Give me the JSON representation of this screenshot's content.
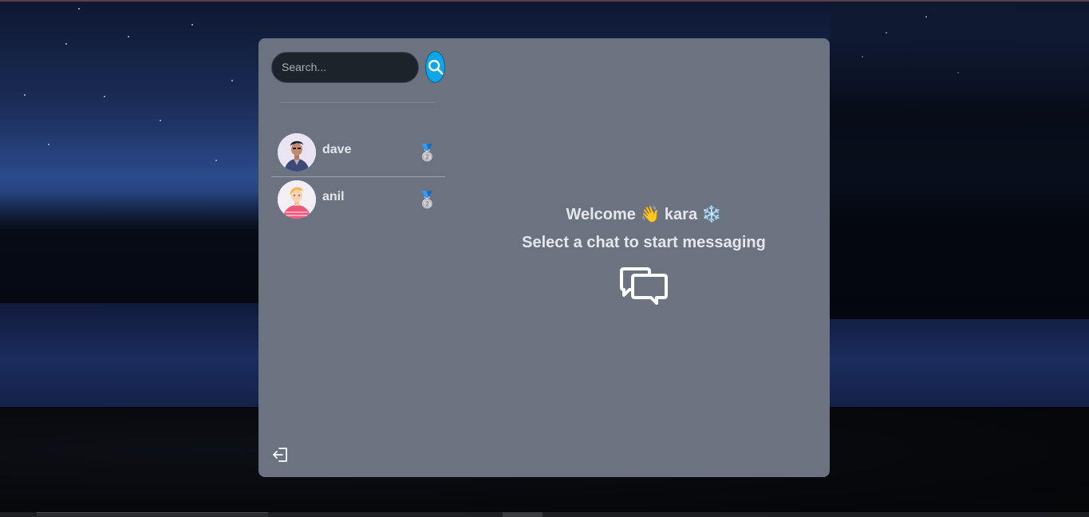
{
  "search": {
    "placeholder": "Search..."
  },
  "conversations": [
    {
      "name": "dave",
      "emoji": "🥈",
      "avatar_icon": "male-avatar-icon"
    },
    {
      "name": "anil",
      "emoji": "🥈",
      "avatar_icon": "female-avatar-icon"
    }
  ],
  "welcome": {
    "prefix": "Welcome",
    "wave": "👋",
    "username": "kara",
    "snowflake": "❄️",
    "subtitle": "Select a chat to start messaging"
  },
  "icons": {
    "search": "search-icon",
    "logout": "logout-icon",
    "chat": "chat-bubbles-icon"
  },
  "colors": {
    "panel": "#6b7280",
    "search_bg": "#1d232a",
    "accent": "#0ea5e9",
    "text": "#e5e7eb"
  }
}
